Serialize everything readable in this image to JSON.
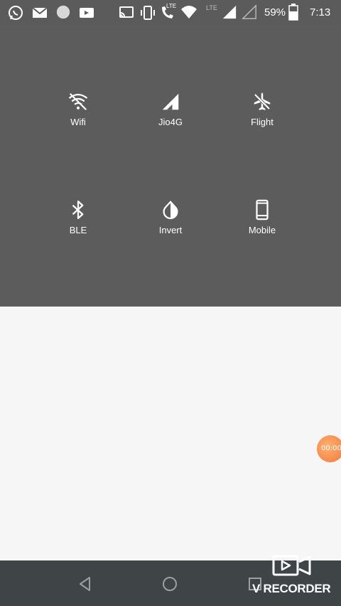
{
  "status_bar": {
    "battery": "59%",
    "time": "7:13",
    "lte_label_1": "LTE",
    "lte_label_2": "LTE",
    "icons": [
      "whatsapp-icon",
      "message-icon",
      "circle-app-icon",
      "video-icon",
      "cast-icon",
      "vibrate-icon",
      "phone-lte-icon",
      "wifi-icon",
      "signal-icon",
      "battery-icon"
    ]
  },
  "tiles": [
    {
      "label": "Wifi",
      "icon": "wifi-off-icon"
    },
    {
      "label": "Jio4G",
      "icon": "signal-icon"
    },
    {
      "label": "Flight",
      "icon": "airplane-icon"
    },
    {
      "label": "BLE",
      "icon": "bluetooth-icon"
    },
    {
      "label": "Invert",
      "icon": "invert-colors-icon"
    },
    {
      "label": "Mobile",
      "icon": "phone-icon"
    }
  ],
  "recorder_bubble": {
    "timer": "00:00"
  },
  "nav": {
    "back": "back-icon",
    "home": "home-icon",
    "recents": "recents-icon"
  },
  "watermark": {
    "text": "V RECORDER"
  },
  "colors": {
    "panel": "#5c5c5c",
    "content": "#f6f6f6",
    "nav": "#3f4447",
    "bubble": "#f2783c"
  }
}
